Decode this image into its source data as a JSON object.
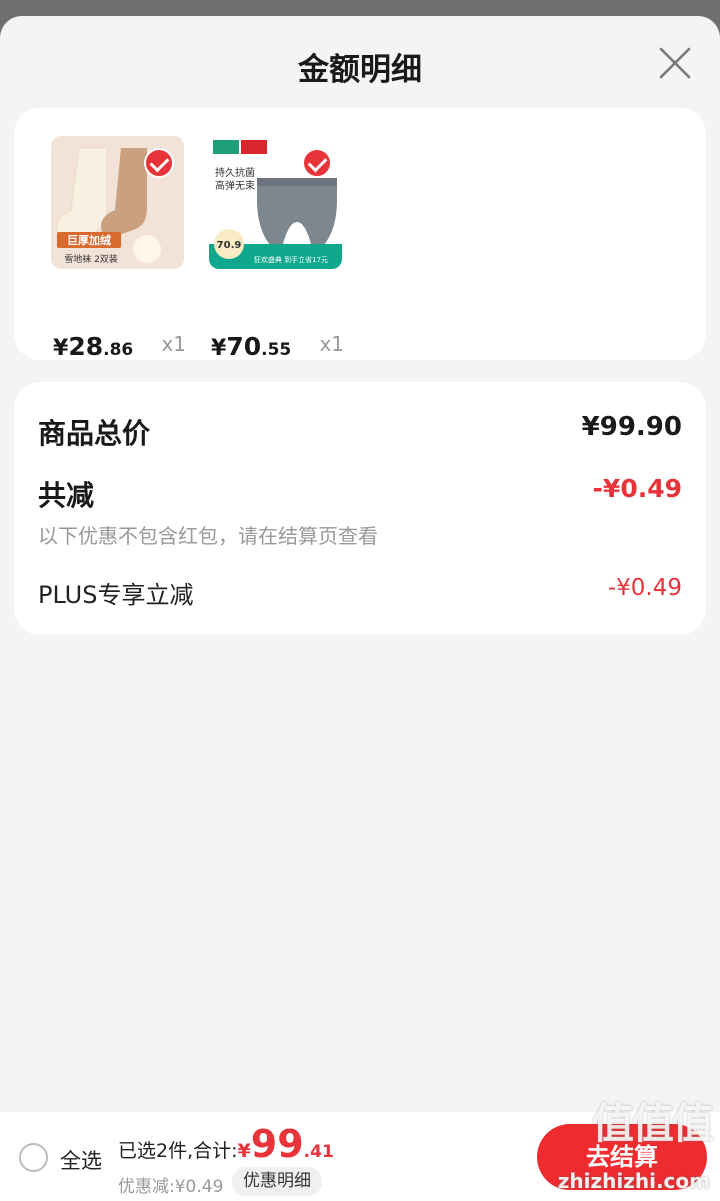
{
  "title": "金额明细",
  "goods": [
    {
      "image_text": [
        "巨厚加绒",
        "雪地袜 2双装"
      ],
      "price_currency": "¥",
      "price_int": "28",
      "price_dec": ".86",
      "qty": "x1"
    },
    {
      "image_text": [
        "持久抗菌",
        "高弹无束",
        "70.9",
        "狂欢盛典 到手立省17元"
      ],
      "price_currency": "¥",
      "price_int": "70",
      "price_dec": ".55",
      "qty": "x1"
    }
  ],
  "summary": {
    "total_label": "商品总价",
    "total_value": "¥99.90",
    "reduce_label": "共减",
    "reduce_value": "-¥0.49",
    "note": "以下优惠不包含红包，请在结算页查看",
    "plus_label": "PLUS专享立减",
    "plus_value": "-¥0.49"
  },
  "bottom": {
    "select_all": "全选",
    "selected_text": "已选2件,合计:",
    "total_currency": "¥",
    "total_int": "99",
    "total_dec": ".41",
    "discount_text": "优惠减:¥0.49",
    "detail_button": "优惠明细",
    "checkout_button": "去结算"
  },
  "watermark": {
    "cn": "值值值",
    "url": "zhizhizhi.com"
  },
  "colors": {
    "accent_red": "#e8333a",
    "checkout_red": "#ee2b2f"
  }
}
